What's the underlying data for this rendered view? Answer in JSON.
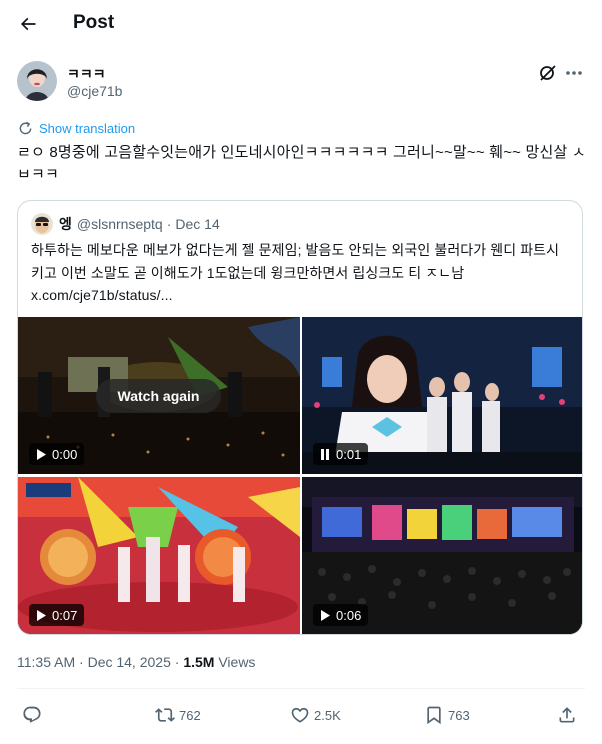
{
  "header": {
    "title": "Post"
  },
  "author": {
    "name": "ㅋㅋㅋ",
    "handle": "@cje71b"
  },
  "translate_label": "Show translation",
  "tweet": {
    "text": "ㄹㅇ 8명중에 고음할수잇는애가 인도네시아인ㅋㅋㅋㅋㅋㅋ 그러니~~말~~ 훼~~ 망신살 ㅅㅂㅋㅋ"
  },
  "quote": {
    "name": "엥",
    "handle": "@slsnrnseptq",
    "separator": "·",
    "date": "Dec 14",
    "text": "하투하는 메보다운 메보가 없다는게 젤 문제임; 발음도 안되는 외국인 불러다가 웬디 파트시키고 이번 소말도 곧 이해도가 1도없는데 윙크만하면서 립싱크도 티 ㅈㄴ남 x.com/cje71b/status/..."
  },
  "media": {
    "watch_again_label": "Watch again",
    "tiles": [
      {
        "time": "0:00",
        "state": "play"
      },
      {
        "time": "0:01",
        "state": "pause"
      },
      {
        "time": "0:07",
        "state": "play"
      },
      {
        "time": "0:06",
        "state": "play"
      }
    ]
  },
  "meta": {
    "time": "11:35 AM",
    "separator": "·",
    "date": "Dec 14, 2025",
    "views_count": "1.5M",
    "views_label": "Views",
    "dot2": "·"
  },
  "actions": {
    "retweets": "762",
    "likes": "2.5K",
    "bookmarks": "763"
  },
  "icons": [
    "back-arrow-icon",
    "grok-icon",
    "more-icon",
    "translate-icon",
    "reply-icon",
    "retweet-icon",
    "like-icon",
    "bookmark-icon",
    "share-icon",
    "play-icon",
    "pause-icon"
  ],
  "colors": {
    "accent": "#1d9bf0",
    "text": "#0f1419",
    "muted": "#536471",
    "border": "#cfd9de"
  }
}
